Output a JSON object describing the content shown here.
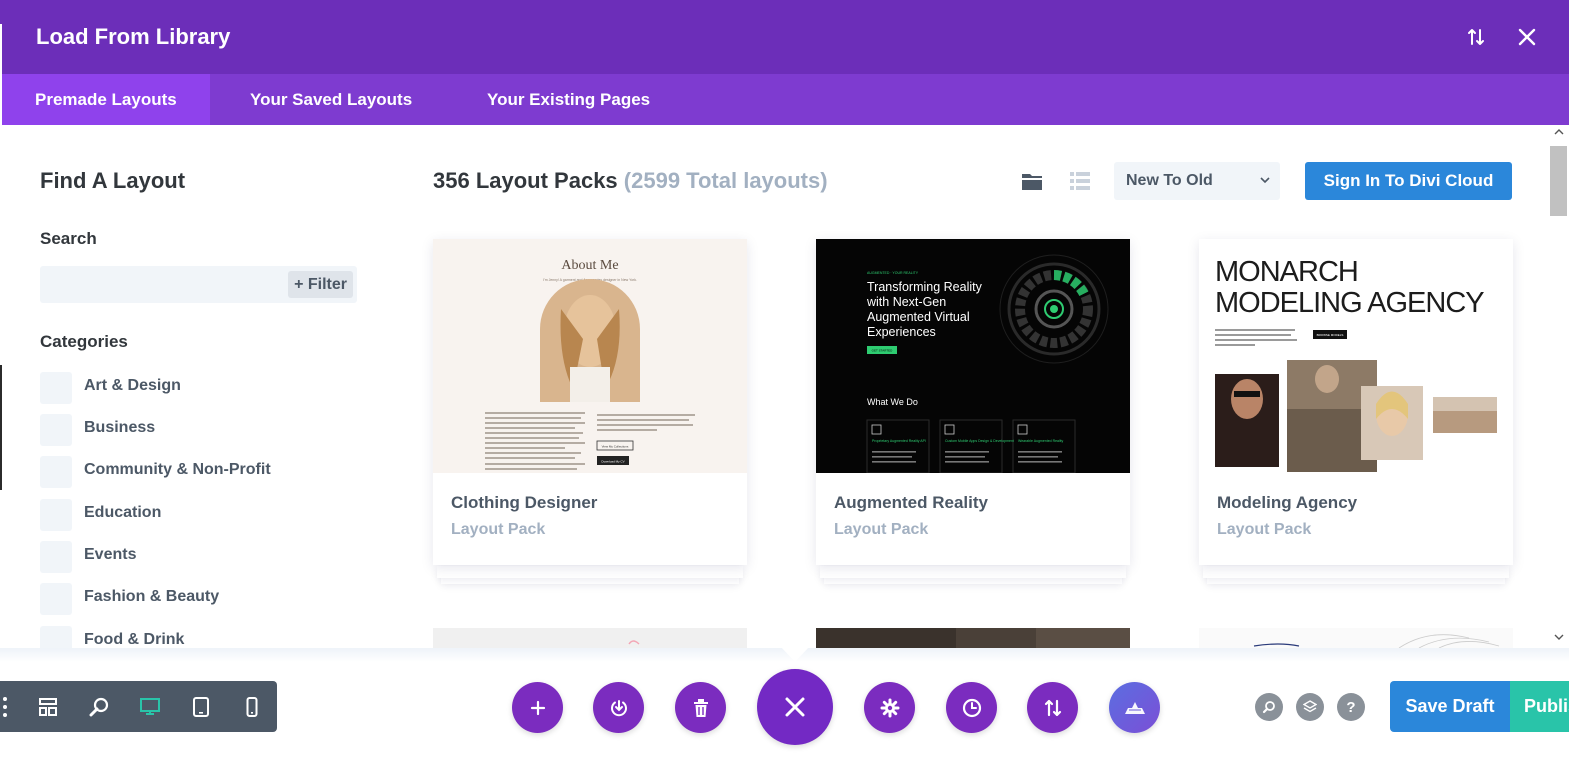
{
  "modal": {
    "title": "Load From Library",
    "tabs": [
      {
        "label": "Premade Layouts",
        "active": true
      },
      {
        "label": "Your Saved Layouts",
        "active": false
      },
      {
        "label": "Your Existing Pages",
        "active": false
      }
    ],
    "header_icons": [
      "sort-arrows-icon",
      "close-icon"
    ]
  },
  "sidebar": {
    "title": "Find A Layout",
    "search_label": "Search",
    "search_value": "",
    "filter_label": "+ Filter",
    "categories_label": "Categories",
    "categories": [
      "Art & Design",
      "Business",
      "Community & Non-Profit",
      "Education",
      "Events",
      "Fashion & Beauty",
      "Food & Drink"
    ]
  },
  "main": {
    "pack_count": "356 Layout Packs",
    "total_layouts": "(2599 Total layouts)",
    "sort_value": "New To Old",
    "signin_label": "Sign In To Divi Cloud",
    "cards": [
      {
        "name": "Clothing Designer",
        "sub": "Layout Pack",
        "thumb": {
          "heading": "About Me",
          "tagline": "I'm Jenny! A garment and Accessories designer in New York.",
          "buttons": [
            "View My Collections",
            "Download My CV"
          ]
        }
      },
      {
        "name": "Augmented Reality",
        "sub": "Layout Pack",
        "thumb": {
          "eyebrow": "AUGMENTED · YOUR REALITY",
          "heading_lines": [
            "Transforming Reality",
            "with Next-Gen",
            "Augmented Virtual",
            "Experiences"
          ],
          "cta": "GET STARTED",
          "section": "What We Do",
          "services": [
            "Proprietary Augmented Reality API",
            "Custom Mobile Apps Design & Development",
            "Wearable Augmented Reality"
          ]
        }
      },
      {
        "name": "Modeling Agency",
        "sub": "Layout Pack",
        "thumb": {
          "heading_lines": [
            "MONARCH",
            "MODELING AGENCY"
          ],
          "cta": "BROWSE MODELS"
        }
      }
    ]
  },
  "toolbar": {
    "left_icons": [
      "drag-handle-icon",
      "wireframe-icon",
      "zoom-icon",
      "desktop-icon",
      "tablet-icon",
      "phone-icon"
    ],
    "center_icons": [
      "add-icon",
      "load-icon",
      "trash-icon",
      "close-icon",
      "settings-icon",
      "history-icon",
      "portability-icon",
      "divi-ai-icon"
    ],
    "right_icons": [
      "search-icon",
      "layers-icon",
      "help-icon"
    ],
    "help_label": "?",
    "save_draft": "Save Draft",
    "publish": "Publish"
  },
  "colors": {
    "header": "#6c2eb9",
    "tabs": "#7e3bd0",
    "active_tab": "#8f42ec",
    "primary_blue": "#2b87da",
    "publish_green": "#29c4a9",
    "purple_button": "#7b2cbf"
  }
}
